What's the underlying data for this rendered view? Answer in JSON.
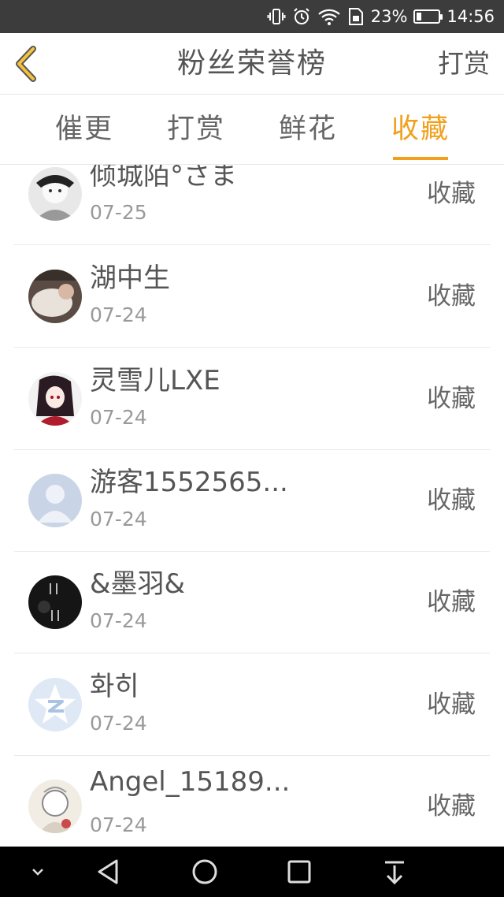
{
  "status_bar": {
    "battery_percent_label": "23%",
    "battery_level": 0.23,
    "time": "14:56",
    "icons": [
      "vibrate-icon",
      "alarm-icon",
      "wifi-icon",
      "sim-icon",
      "battery-icon"
    ]
  },
  "header": {
    "title": "粉丝荣誉榜",
    "right_action": "打赏",
    "back_icon": "chevron-left-icon",
    "accent_color": "#f0a01c"
  },
  "tabs": [
    {
      "label": "催更",
      "active": false
    },
    {
      "label": "打赏",
      "active": false
    },
    {
      "label": "鲜花",
      "active": false
    },
    {
      "label": "收藏",
      "active": true
    }
  ],
  "fans": [
    {
      "name": "倾城陌°さま",
      "date": "07-25",
      "action": "收藏"
    },
    {
      "name": "湖中生",
      "date": "07-24",
      "action": "收藏"
    },
    {
      "name": "灵雪儿LXE",
      "date": "07-24",
      "action": "收藏"
    },
    {
      "name": "游客1552565...",
      "date": "07-24",
      "action": "收藏"
    },
    {
      "name": "&墨羽&",
      "date": "07-24",
      "action": "收藏"
    },
    {
      "name": "화히",
      "date": "07-24",
      "action": "收藏"
    },
    {
      "name": "Angel_15189...",
      "date": "07-24",
      "action": "收藏"
    }
  ],
  "nav_bar": {
    "icons": [
      "chevron-down-icon",
      "back-triangle-icon",
      "home-circle-icon",
      "recents-square-icon",
      "notification-pull-icon"
    ]
  }
}
